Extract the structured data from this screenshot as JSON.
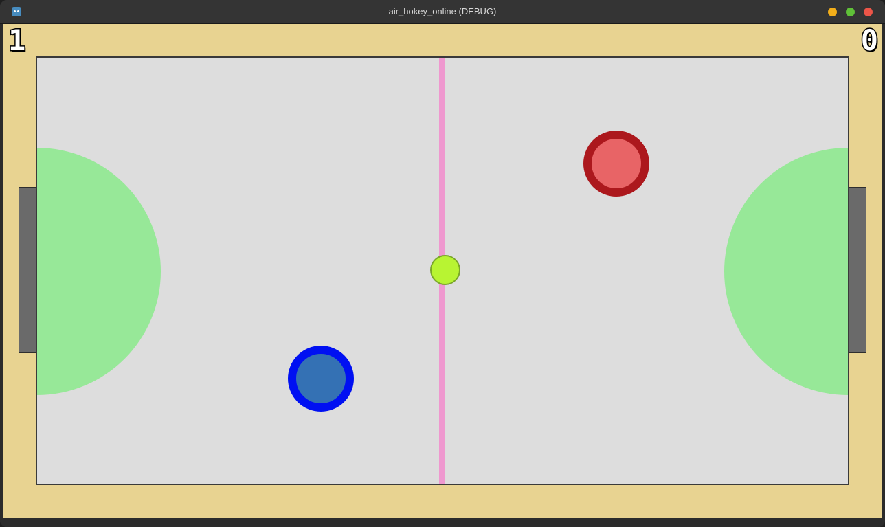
{
  "window": {
    "title": "air_hokey_online (DEBUG)",
    "app_icon": "godot-icon",
    "buttons": [
      {
        "name": "minimize-button",
        "color": "#f2ae1a"
      },
      {
        "name": "maximize-button",
        "color": "#5fc038"
      },
      {
        "name": "close-button",
        "color": "#ec5548"
      }
    ]
  },
  "scoreboard": {
    "left_score": "1",
    "right_score": "0"
  },
  "colors": {
    "background": "#e8d391",
    "rink": "#dddddd",
    "crease": "#97e898",
    "center_line": "#ef98cf",
    "puck": "#b8f432",
    "blue_paddle_ring": "#0010f2",
    "blue_paddle_fill": "#3471b4",
    "red_paddle_ring": "#ac181d",
    "red_paddle_fill": "#e86466",
    "goal": "#6a6a6a"
  }
}
